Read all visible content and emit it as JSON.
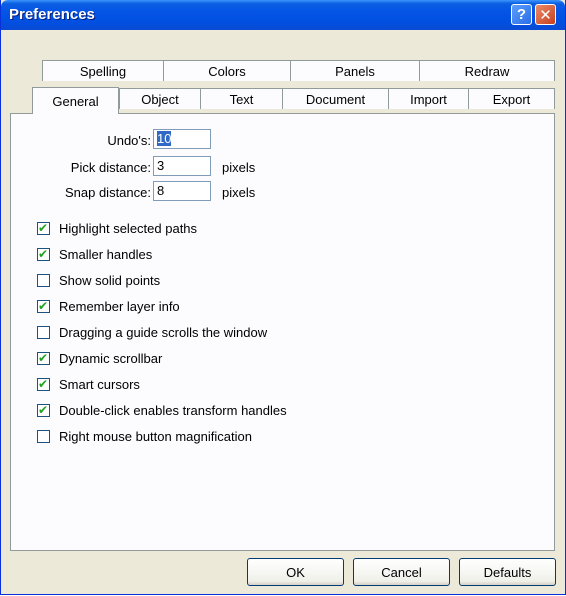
{
  "window": {
    "title": "Preferences",
    "help_glyph": "?",
    "close_glyph": "✕"
  },
  "tabs_back": [
    {
      "label": "Spelling"
    },
    {
      "label": "Colors"
    },
    {
      "label": "Panels"
    },
    {
      "label": "Redraw"
    }
  ],
  "tabs_front": [
    {
      "label": "General",
      "active": true
    },
    {
      "label": "Object"
    },
    {
      "label": "Text"
    },
    {
      "label": "Document"
    },
    {
      "label": "Import"
    },
    {
      "label": "Export"
    }
  ],
  "fields": [
    {
      "label": "Undo's:",
      "value": "10",
      "unit": ""
    },
    {
      "label": "Pick distance:",
      "value": "3",
      "unit": "pixels"
    },
    {
      "label": "Snap distance:",
      "value": "8",
      "unit": "pixels"
    }
  ],
  "options": [
    {
      "label": "Highlight selected paths",
      "checked": true
    },
    {
      "label": "Smaller handles",
      "checked": true
    },
    {
      "label": "Show solid points",
      "checked": false
    },
    {
      "label": "Remember layer info",
      "checked": true
    },
    {
      "label": "Dragging a guide scrolls the window",
      "checked": false
    },
    {
      "label": "Dynamic scrollbar",
      "checked": true
    },
    {
      "label": "Smart cursors",
      "checked": true
    },
    {
      "label": "Double-click enables transform handles",
      "checked": true
    },
    {
      "label": "Right mouse button magnification",
      "checked": false
    }
  ],
  "buttons": {
    "ok": "OK",
    "cancel": "Cancel",
    "defaults": "Defaults"
  }
}
